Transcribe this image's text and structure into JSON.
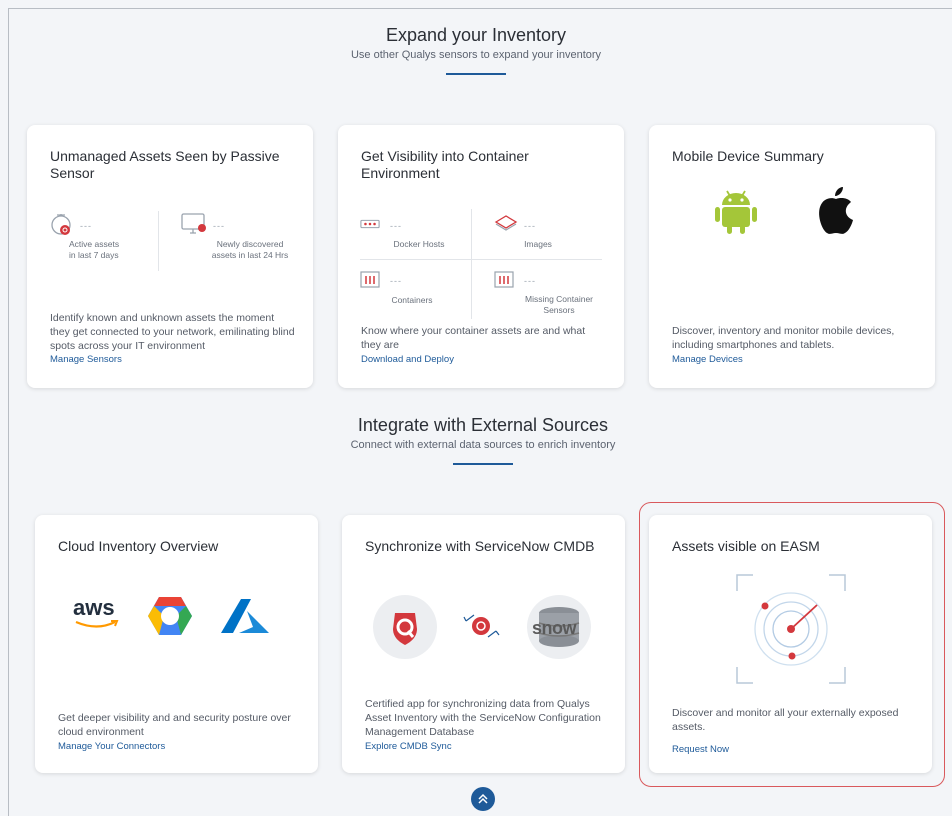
{
  "expand": {
    "title": "Expand your Inventory",
    "subtitle": "Use other Qualys sensors to expand your inventory"
  },
  "integrate": {
    "title": "Integrate with External Sources",
    "subtitle": "Connect with external data sources to enrich inventory"
  },
  "cards": {
    "passive": {
      "title": "Unmanaged Assets Seen by Passive Sensor",
      "stat1": {
        "value": "---",
        "label_line1": "Active assets",
        "label_line2": "in last 7 days"
      },
      "stat2": {
        "value": "---",
        "label_line1": "Newly discovered",
        "label_line2": "assets in last 24 Hrs"
      },
      "description": "Identify known and unknown assets the moment they get connected to your network, emilinating blind spots across your IT environment",
      "link": "Manage Sensors"
    },
    "container": {
      "title": "Get Visibility into Container Environment",
      "docker_hosts": {
        "value": "---",
        "label": "Docker Hosts"
      },
      "images": {
        "value": "---",
        "label": "Images"
      },
      "containers": {
        "value": "---",
        "label": "Containers"
      },
      "missing": {
        "value": "---",
        "label_line1": "Missing Container",
        "label_line2": "Sensors"
      },
      "description": "Know where your container assets are and what they are",
      "link": "Download and Deploy"
    },
    "mobile": {
      "title": "Mobile Device Summary",
      "description": "Discover, inventory and monitor mobile devices, including smartphones and tablets.",
      "link": "Manage Devices"
    },
    "cloud": {
      "title": "Cloud Inventory Overview",
      "aws_text": "aws",
      "description": "Get deeper visibility and and security posture over cloud environment",
      "link": "Manage Your Connectors"
    },
    "servicenow": {
      "title": "Synchronize with ServiceNow CMDB",
      "snow_text": "snow",
      "description": "Certified app for synchronizing data from Qualys Asset Inventory with the ServiceNow Configuration Management Database",
      "link": "Explore CMDB Sync"
    },
    "easm": {
      "title": "Assets visible on EASM",
      "description": "Discover and monitor all your externally exposed assets.",
      "link": "Request Now"
    }
  },
  "colors": {
    "accent": "#1e5a99",
    "highlight": "#d9595c",
    "qualys_red": "#d3383d",
    "android_green": "#a4c639"
  }
}
